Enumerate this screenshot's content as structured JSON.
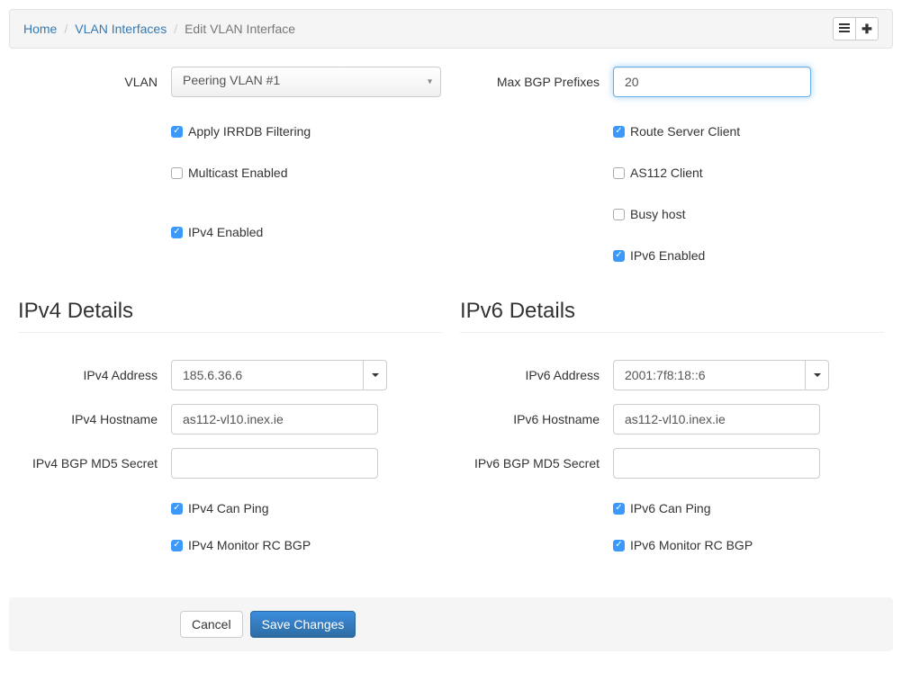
{
  "breadcrumb": {
    "home": "Home",
    "vlan_interfaces": "VLAN Interfaces",
    "current": "Edit VLAN Interface"
  },
  "labels": {
    "vlan": "VLAN",
    "max_bgp": "Max BGP Prefixes",
    "apply_irrdb": "Apply IRRDB Filtering",
    "route_server": "Route Server Client",
    "multicast": "Multicast Enabled",
    "as112": "AS112 Client",
    "busy_host": "Busy host",
    "ipv4_enabled": "IPv4 Enabled",
    "ipv6_enabled": "IPv6 Enabled",
    "ipv4_details": "IPv4 Details",
    "ipv6_details": "IPv6 Details",
    "ipv4_address": "IPv4 Address",
    "ipv6_address": "IPv6 Address",
    "ipv4_hostname": "IPv4 Hostname",
    "ipv6_hostname": "IPv6 Hostname",
    "ipv4_md5": "IPv4 BGP MD5 Secret",
    "ipv6_md5": "IPv6 BGP MD5 Secret",
    "ipv4_ping": "IPv4 Can Ping",
    "ipv6_ping": "IPv6 Can Ping",
    "ipv4_monitor": "IPv4 Monitor RC BGP",
    "ipv6_monitor": "IPv6 Monitor RC BGP",
    "cancel": "Cancel",
    "save": "Save Changes"
  },
  "values": {
    "vlan_selected": "Peering VLAN #1",
    "max_bgp": "20",
    "ipv4_address": "185.6.36.6",
    "ipv6_address": "2001:7f8:18::6",
    "ipv4_hostname": "as112-vl10.inex.ie",
    "ipv6_hostname": "as112-vl10.inex.ie",
    "ipv4_md5": "",
    "ipv6_md5": ""
  },
  "checks": {
    "apply_irrdb": true,
    "route_server": true,
    "multicast": false,
    "as112": false,
    "busy_host": false,
    "ipv4_enabled": true,
    "ipv6_enabled": true,
    "ipv4_ping": true,
    "ipv6_ping": true,
    "ipv4_monitor": true,
    "ipv6_monitor": true
  }
}
